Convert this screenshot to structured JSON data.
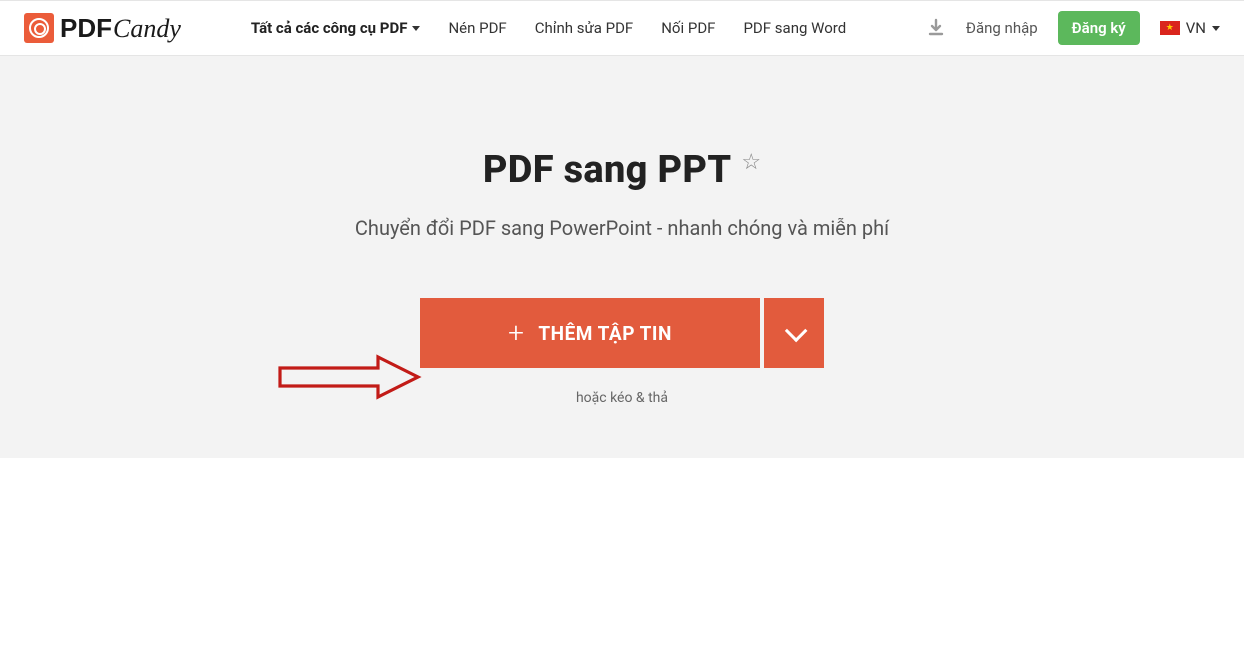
{
  "brand": {
    "name_pdf": "PDF",
    "name_candy": "Candy"
  },
  "nav": {
    "all_tools": "Tất cả các công cụ PDF",
    "compress": "Nén PDF",
    "edit": "Chỉnh sửa PDF",
    "merge": "Nối PDF",
    "to_word": "PDF sang Word"
  },
  "header": {
    "login": "Đăng nhập",
    "signup": "Đăng ký",
    "lang_code": "VN"
  },
  "page": {
    "title": "PDF sang PPT",
    "subtitle": "Chuyển đổi PDF sang PowerPoint - nhanh chóng và miễn phí",
    "add_file": "THÊM TẬP TIN",
    "drag_hint": "hoặc kéo & thả"
  },
  "colors": {
    "accent": "#e25b3d",
    "green": "#5cb85c",
    "hero_bg": "#f3f3f3"
  }
}
